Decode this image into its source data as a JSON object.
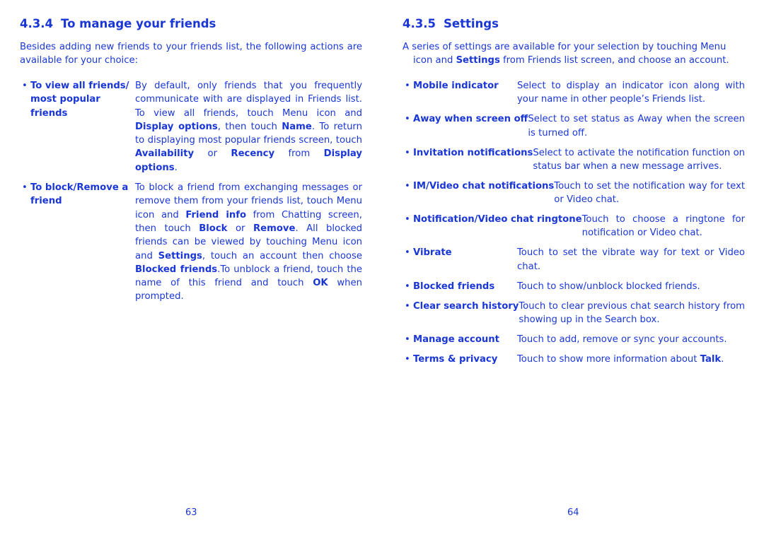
{
  "left_page": {
    "section_number": "4.3.4",
    "section_title": "To manage your friends",
    "intro": "Besides adding new friends to your friends list, the following actions are available for your choice:",
    "items": [
      {
        "term": "To view all friends/ most popular friends",
        "desc_parts": [
          {
            "t": "By default, only friends that you frequently communicate with are displayed in Friends list. To view all friends, touch Menu icon ",
            "b": false
          },
          {
            "t": "  and ",
            "b": false
          },
          {
            "t": "Display options",
            "b": true
          },
          {
            "t": ", then touch ",
            "b": false
          },
          {
            "t": "Name",
            "b": true
          },
          {
            "t": ". To return to displaying most popular friends screen, touch ",
            "b": false
          },
          {
            "t": "Availability",
            "b": true
          },
          {
            "t": " or ",
            "b": false
          },
          {
            "t": "Recency",
            "b": true
          },
          {
            "t": " from ",
            "b": false
          },
          {
            "t": "Display options",
            "b": true
          },
          {
            "t": ".",
            "b": false
          }
        ]
      },
      {
        "term": "To block/Remove a friend",
        "desc_parts": [
          {
            "t": "To block a friend from exchanging messages or remove them from your friends list, touch Menu icon ",
            "b": false
          },
          {
            "t": "  and ",
            "b": false
          },
          {
            "t": "Friend info",
            "b": true
          },
          {
            "t": " from Chatting screen, then touch ",
            "b": false
          },
          {
            "t": "Block",
            "b": true
          },
          {
            "t": " or ",
            "b": false
          },
          {
            "t": "Remove",
            "b": true
          },
          {
            "t": ". All blocked friends can be viewed by touching Menu icon ",
            "b": false
          },
          {
            "t": "  and ",
            "b": false
          },
          {
            "t": "Settings",
            "b": true
          },
          {
            "t": ", touch an account then choose ",
            "b": false
          },
          {
            "t": "Blocked friends",
            "b": true
          },
          {
            "t": ".To unblock a friend, touch the name of this friend and touch ",
            "b": false
          },
          {
            "t": "OK",
            "b": true
          },
          {
            "t": " when prompted.",
            "b": false
          }
        ]
      }
    ],
    "page_number": "63"
  },
  "right_page": {
    "section_number": "4.3.5",
    "section_title": "Settings",
    "intro_parts": [
      {
        "t": "A series of settings are available for your selection by touching Menu icon ",
        "b": false
      },
      {
        "t": "  and ",
        "b": false
      },
      {
        "t": "Settings",
        "b": true
      },
      {
        "t": " from Friends list screen, and choose an account.",
        "b": false
      }
    ],
    "items": [
      {
        "term": "Mobile indicator",
        "desc_parts": [
          {
            "t": "Select to display an indicator icon along with your name in other people’s Friends list.",
            "b": false
          }
        ]
      },
      {
        "term": "Away when screen off",
        "desc_parts": [
          {
            "t": "Select to set status as Away when the screen is turned off.",
            "b": false
          }
        ]
      },
      {
        "term": "Invitation notifications",
        "desc_parts": [
          {
            "t": "Select to activate the notification function on status bar when a new message arrives.",
            "b": false
          }
        ]
      },
      {
        "term": "IM/Video chat notifications",
        "desc_parts": [
          {
            "t": "Touch to set the notification way for text or Video chat.",
            "b": false
          }
        ]
      },
      {
        "term": "Notification/Video chat ringtone",
        "desc_parts": [
          {
            "t": "Touch to choose a ringtone for notification or Video chat.",
            "b": false
          }
        ]
      },
      {
        "term": "Vibrate",
        "desc_parts": [
          {
            "t": "Touch to set the vibrate way for text or Video chat.",
            "b": false
          }
        ]
      },
      {
        "term": "Blocked friends",
        "desc_parts": [
          {
            "t": "Touch to show/unblock blocked friends.",
            "b": false
          }
        ]
      },
      {
        "term": "Clear search history",
        "desc_parts": [
          {
            "t": "Touch to clear previous chat search history from showing up in the Search box.",
            "b": false
          }
        ]
      },
      {
        "term": "Manage account",
        "desc_parts": [
          {
            "t": "Touch to add, remove or sync your accounts.",
            "b": false
          }
        ]
      },
      {
        "term": "Terms & privacy",
        "desc_parts": [
          {
            "t": "Touch to show more information about ",
            "b": false
          },
          {
            "t": "Talk",
            "b": true
          },
          {
            "t": ".",
            "b": false
          }
        ]
      }
    ],
    "page_number": "64"
  },
  "colors": {
    "text": "#1a37d6",
    "background": "#ffffff"
  }
}
